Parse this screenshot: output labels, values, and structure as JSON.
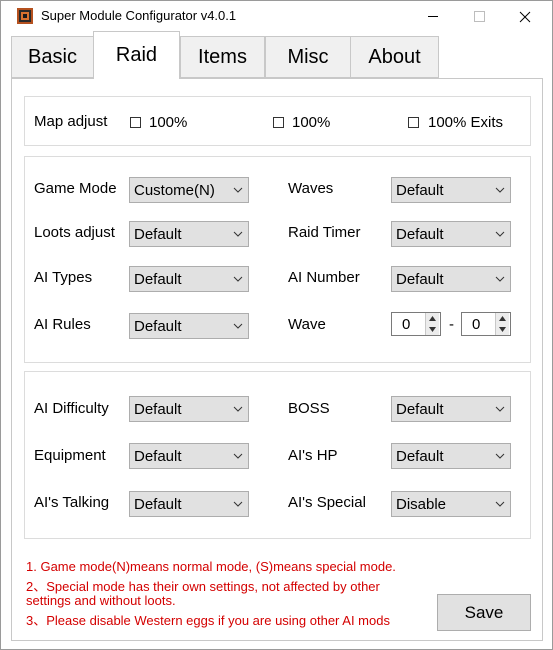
{
  "window": {
    "title": "Super Module Configurator v4.0.1"
  },
  "tabs": [
    {
      "label": "Basic",
      "active": false
    },
    {
      "label": "Raid",
      "active": true
    },
    {
      "label": "Items",
      "active": false
    },
    {
      "label": "Misc",
      "active": false
    },
    {
      "label": "About",
      "active": false
    }
  ],
  "map_adjust": {
    "label": "Map adjust",
    "options": [
      {
        "label": "100%",
        "checked": false
      },
      {
        "label": "100%",
        "checked": false
      },
      {
        "label": "100% Exits",
        "checked": false
      }
    ]
  },
  "raid_settings": {
    "game_mode": {
      "label": "Game Mode",
      "value": "Custome(N)"
    },
    "waves": {
      "label": "Waves",
      "value": "Default"
    },
    "loots_adjust": {
      "label": "Loots adjust",
      "value": "Default"
    },
    "raid_timer": {
      "label": "Raid Timer",
      "value": "Default"
    },
    "ai_types": {
      "label": "AI Types",
      "value": "Default"
    },
    "ai_number": {
      "label": "AI Number",
      "value": "Default"
    },
    "ai_rules": {
      "label": "AI Rules",
      "value": "Default"
    },
    "wave": {
      "label": "Wave",
      "min": "0",
      "separator": "-",
      "max": "0"
    }
  },
  "ai_settings": {
    "ai_difficulty": {
      "label": "AI Difficulty",
      "value": "Default"
    },
    "boss": {
      "label": "BOSS",
      "value": "Default"
    },
    "equipment": {
      "label": "Equipment",
      "value": "Default"
    },
    "ai_hp": {
      "label": "AI's HP",
      "value": "Default"
    },
    "ai_talking": {
      "label": "AI's Talking",
      "value": "Default"
    },
    "ai_special": {
      "label": "AI's Special",
      "value": "Disable"
    }
  },
  "notes": [
    "1. Game mode(N)means normal mode, (S)means special mode.",
    "2、Special mode has their own settings, not affected by other",
    "settings and without loots.",
    "3、Please disable Western eggs if you are using other AI mods"
  ],
  "save_label": "Save",
  "colors": {
    "note_text": "#d40000",
    "combo_bg": "#e1e1e1",
    "icon_accent": "#b5511f"
  }
}
